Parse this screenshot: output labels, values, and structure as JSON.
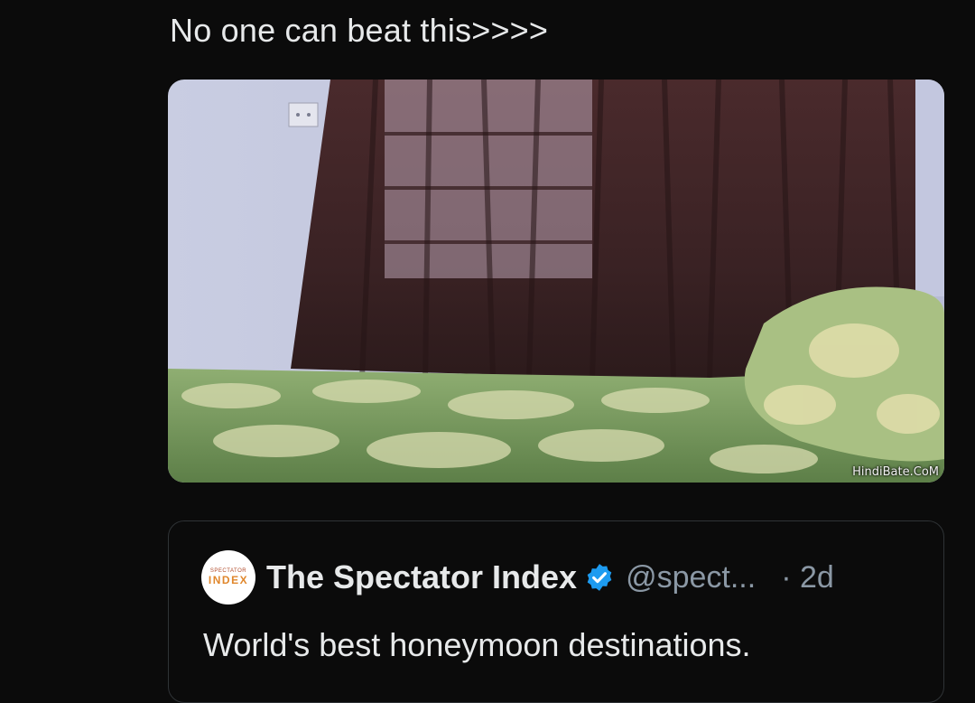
{
  "tweet": {
    "text": "No one can beat this>>>>"
  },
  "media": {
    "watermark": "HindiBate.CoM"
  },
  "quoted_tweet": {
    "avatar_top": "SPECTATOR",
    "avatar_bottom": "INDEX",
    "author_name": "The Spectator Index",
    "handle": "@spect...",
    "time": "· 2d",
    "text": "World's best honeymoon destinations."
  },
  "colors": {
    "background": "#0b0b0b",
    "verified_badge": "#1d9bf0",
    "secondary_text": "#8b98a5",
    "primary_text": "#e7e9ea"
  }
}
